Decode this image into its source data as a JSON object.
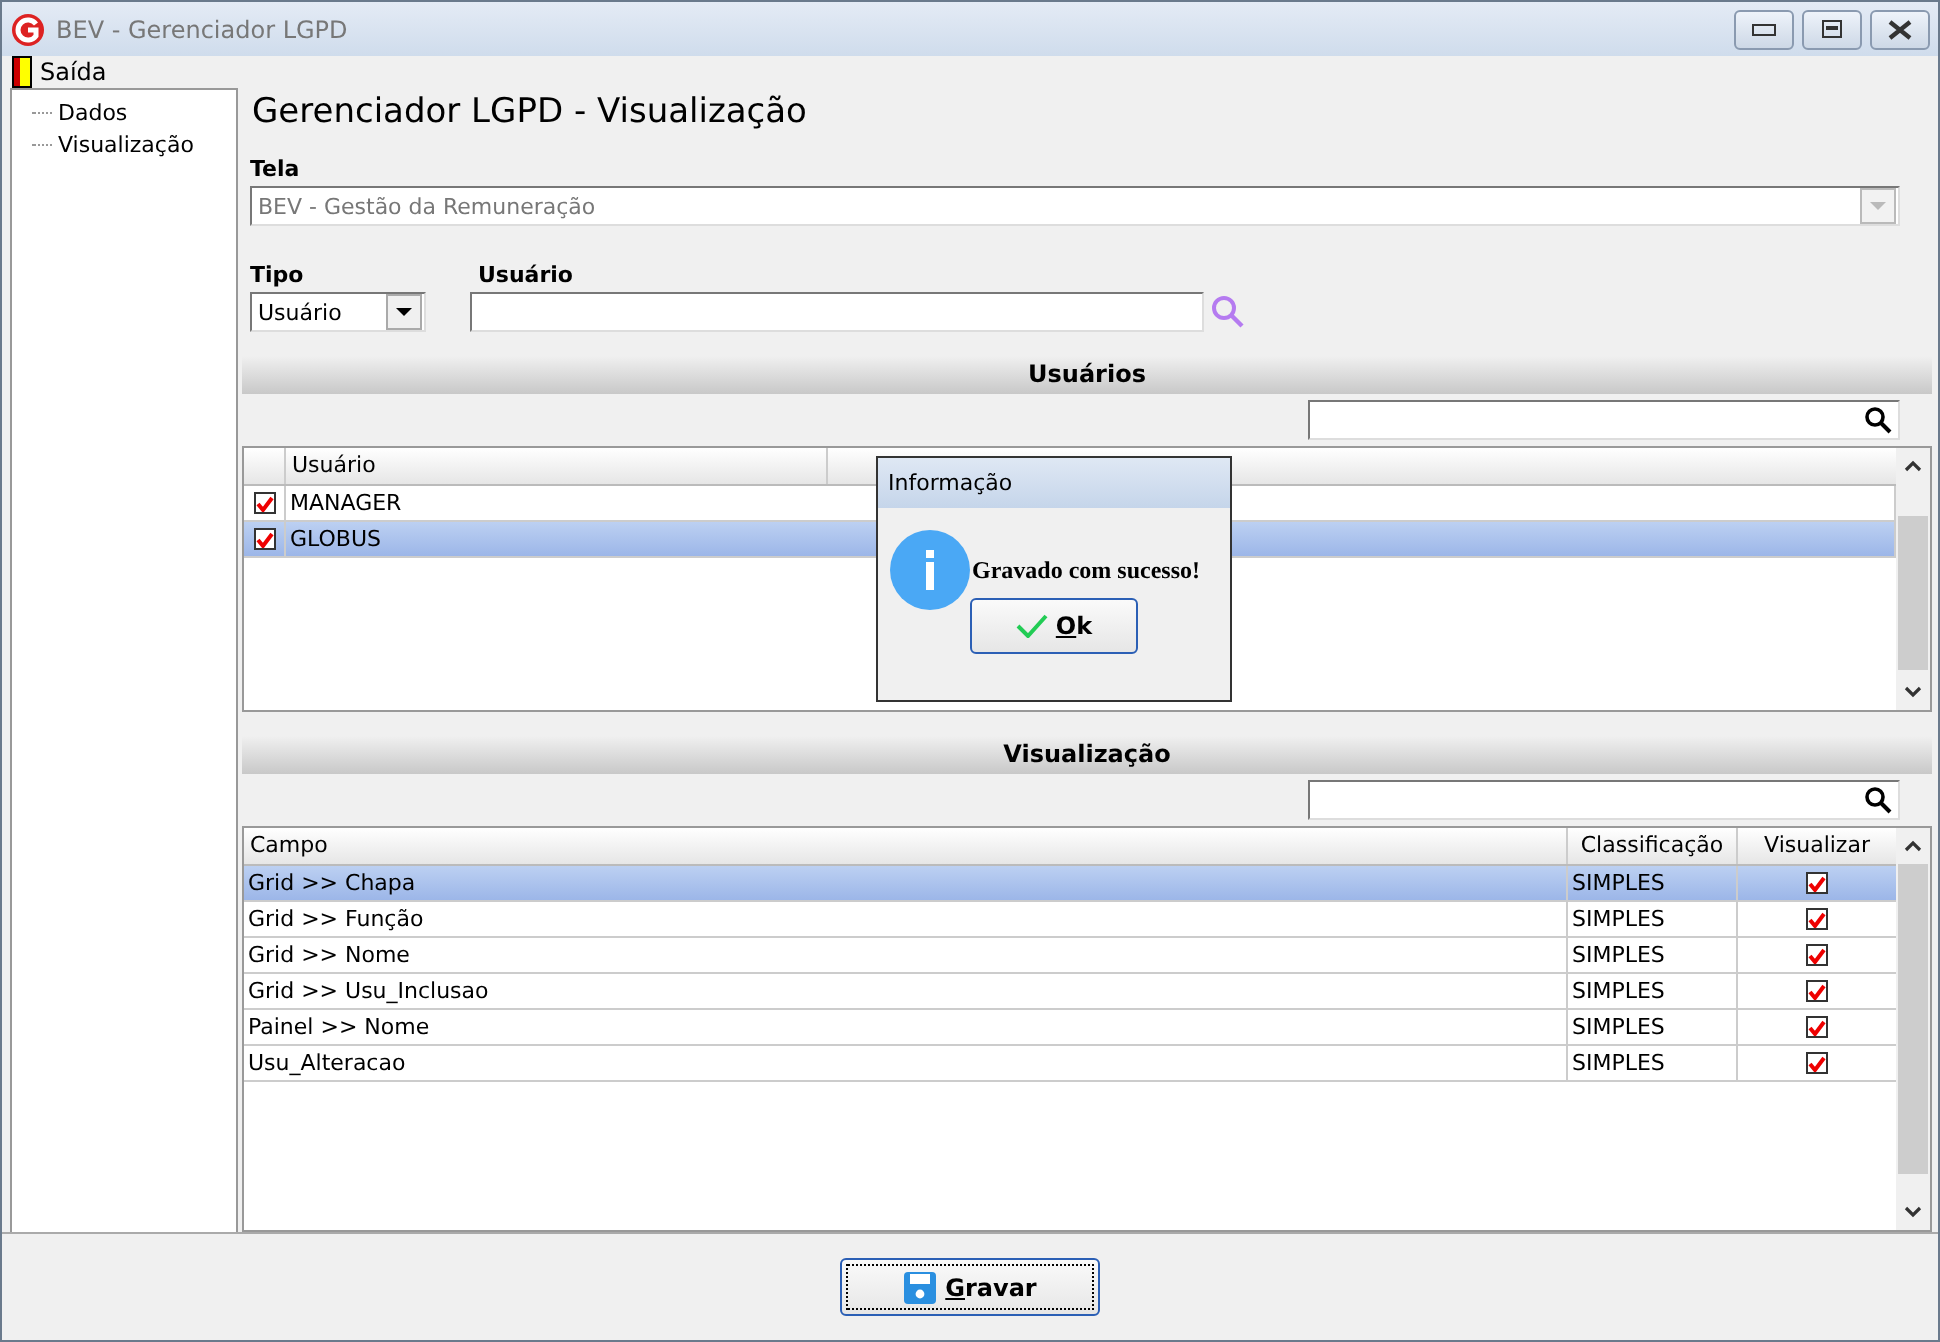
{
  "window": {
    "title": "BEV - Gerenciador LGPD"
  },
  "menu": [
    {
      "label": "Saída"
    }
  ],
  "tree": {
    "items": [
      {
        "label": "Dados",
        "selected": false
      },
      {
        "label": "Visualização",
        "selected": false
      }
    ]
  },
  "page_title": "Gerenciador LGPD - Visualização",
  "tela": {
    "label": "Tela",
    "value": "BEV - Gestão da Remuneração",
    "disabled": true
  },
  "tipo": {
    "label": "Tipo",
    "value": "Usuário"
  },
  "usuario": {
    "label": "Usuário"
  },
  "users_section": {
    "title": "Usuários",
    "columns": [
      "Usuário"
    ],
    "rows": [
      {
        "checked": true,
        "name": "MANAGER",
        "selected": false
      },
      {
        "checked": true,
        "name": "GLOBUS",
        "selected": true
      }
    ]
  },
  "view_section": {
    "title": "Visualização",
    "columns": [
      "Campo",
      "Classificação",
      "Visualizar"
    ],
    "rows": [
      {
        "campo": "Grid >> Chapa",
        "classificacao": "SIMPLES",
        "checked": true,
        "selected": true
      },
      {
        "campo": "Grid >> Função",
        "classificacao": "SIMPLES",
        "checked": true,
        "selected": false
      },
      {
        "campo": "Grid >> Nome",
        "classificacao": "SIMPLES",
        "checked": true,
        "selected": false
      },
      {
        "campo": "Grid >> Usu_Inclusao",
        "classificacao": "SIMPLES",
        "checked": true,
        "selected": false
      },
      {
        "campo": "Painel >> Nome",
        "classificacao": "SIMPLES",
        "checked": true,
        "selected": false
      },
      {
        "campo": "Usu_Alteracao",
        "classificacao": "SIMPLES",
        "checked": true,
        "selected": false
      }
    ]
  },
  "save_button": "Gravar",
  "dialog": {
    "title": "Informação",
    "message": "Gravado com sucesso!",
    "button": "Ok"
  }
}
